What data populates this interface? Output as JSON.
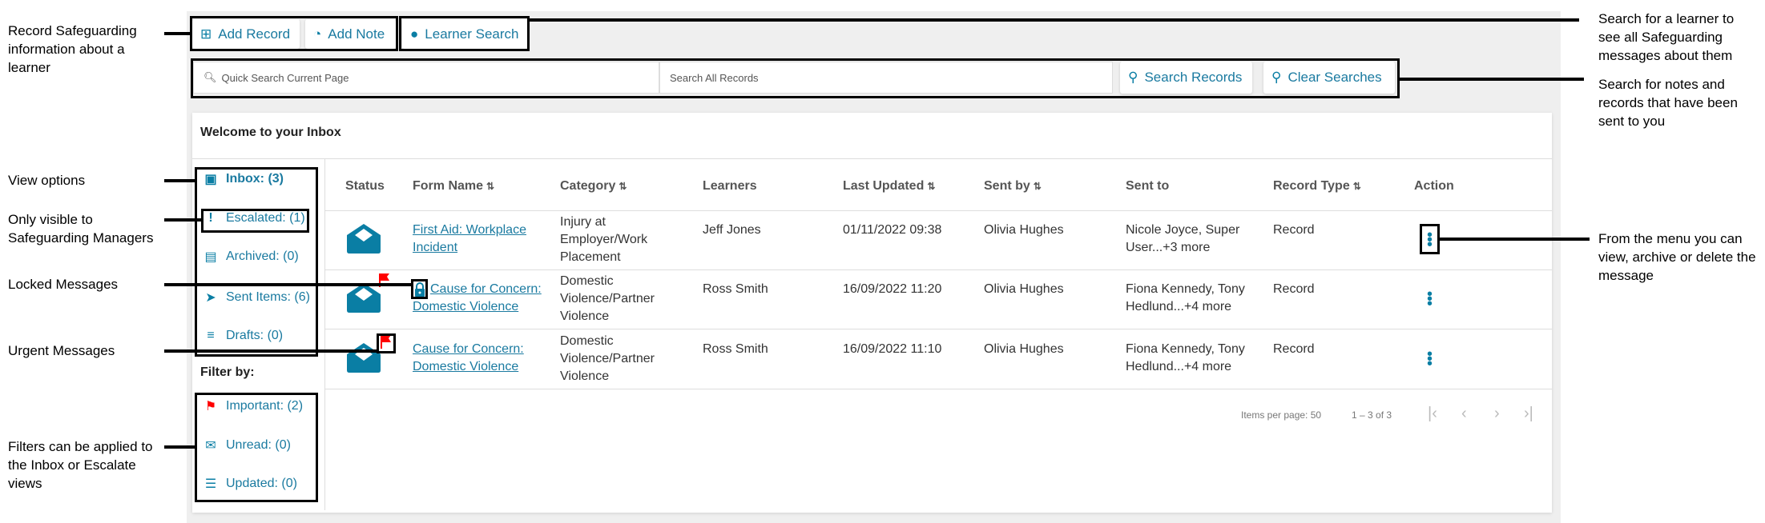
{
  "toolbar": {
    "add_record": "Add Record",
    "add_note": "Add Note",
    "learner_search": "Learner Search"
  },
  "search": {
    "quick_placeholder": "Quick Search Current Page",
    "all_placeholder": "Search All Records",
    "search_records": "Search Records",
    "clear_searches": "Clear Searches"
  },
  "inbox": {
    "title": "Welcome to your Inbox"
  },
  "sidebar": {
    "views": [
      {
        "label": "Inbox: (3)",
        "icon": "inbox-icon"
      },
      {
        "label": "Escalated: (1)",
        "icon": "exclamation-icon"
      },
      {
        "label": "Archived: (0)",
        "icon": "archive-icon"
      },
      {
        "label": "Sent Items: (6)",
        "icon": "send-icon"
      },
      {
        "label": "Drafts: (0)",
        "icon": "drafts-icon"
      }
    ],
    "filter_title": "Filter by:",
    "filters": [
      {
        "label": "Important: (2)",
        "icon": "flag-icon"
      },
      {
        "label": "Unread: (0)",
        "icon": "envelope-icon"
      },
      {
        "label": "Updated: (0)",
        "icon": "list-icon"
      }
    ]
  },
  "table": {
    "headers": [
      "Status",
      "Form Name",
      "Category",
      "Learners",
      "Last Updated",
      "Sent by",
      "Sent to",
      "Record Type",
      "Action"
    ],
    "rows": [
      {
        "form": "First Aid: Workplace Incident",
        "category": "Injury at Employer/Work Placement",
        "learner": "Jeff Jones",
        "updated": "01/11/2022 09:38",
        "sent_by": "Olivia Hughes",
        "sent_to": "Nicole Joyce, Super User...+3 more",
        "type": "Record",
        "locked": false,
        "urgent": false
      },
      {
        "form": "Cause for Concern: Domestic Violence",
        "category": "Domestic Violence/Partner Violence",
        "learner": "Ross Smith",
        "updated": "16/09/2022 11:20",
        "sent_by": "Olivia Hughes",
        "sent_to": "Fiona Kennedy, Tony Hedlund...+4 more",
        "type": "Record",
        "locked": true,
        "urgent": true
      },
      {
        "form": "Cause for Concern: Domestic Violence",
        "category": "Domestic Violence/Partner Violence",
        "learner": "Ross Smith",
        "updated": "16/09/2022 11:10",
        "sent_by": "Olivia Hughes",
        "sent_to": "Fiona Kennedy, Tony Hedlund...+4 more",
        "type": "Record",
        "locked": false,
        "urgent": true
      }
    ]
  },
  "pagination": {
    "items_per_page": "Items per page: 50",
    "range": "1 – 3 of 3"
  },
  "annotations": {
    "record": "Record Safeguarding information about a learner",
    "view_options": "View options",
    "only_visible": "Only visible to Safeguarding Managers",
    "locked": "Locked Messages",
    "urgent": "Urgent Messages",
    "filters": "Filters can be applied to the Inbox or Escalate views",
    "learner_search": "Search for a learner to see all Safeguarding messages about them",
    "search": "Search for notes and records that have been sent to you",
    "menu": "From the menu you can view, archive or delete the message"
  },
  "colors": {
    "accent": "#0a7ea4",
    "urgent": "#ff0000",
    "background": "#efefef"
  }
}
